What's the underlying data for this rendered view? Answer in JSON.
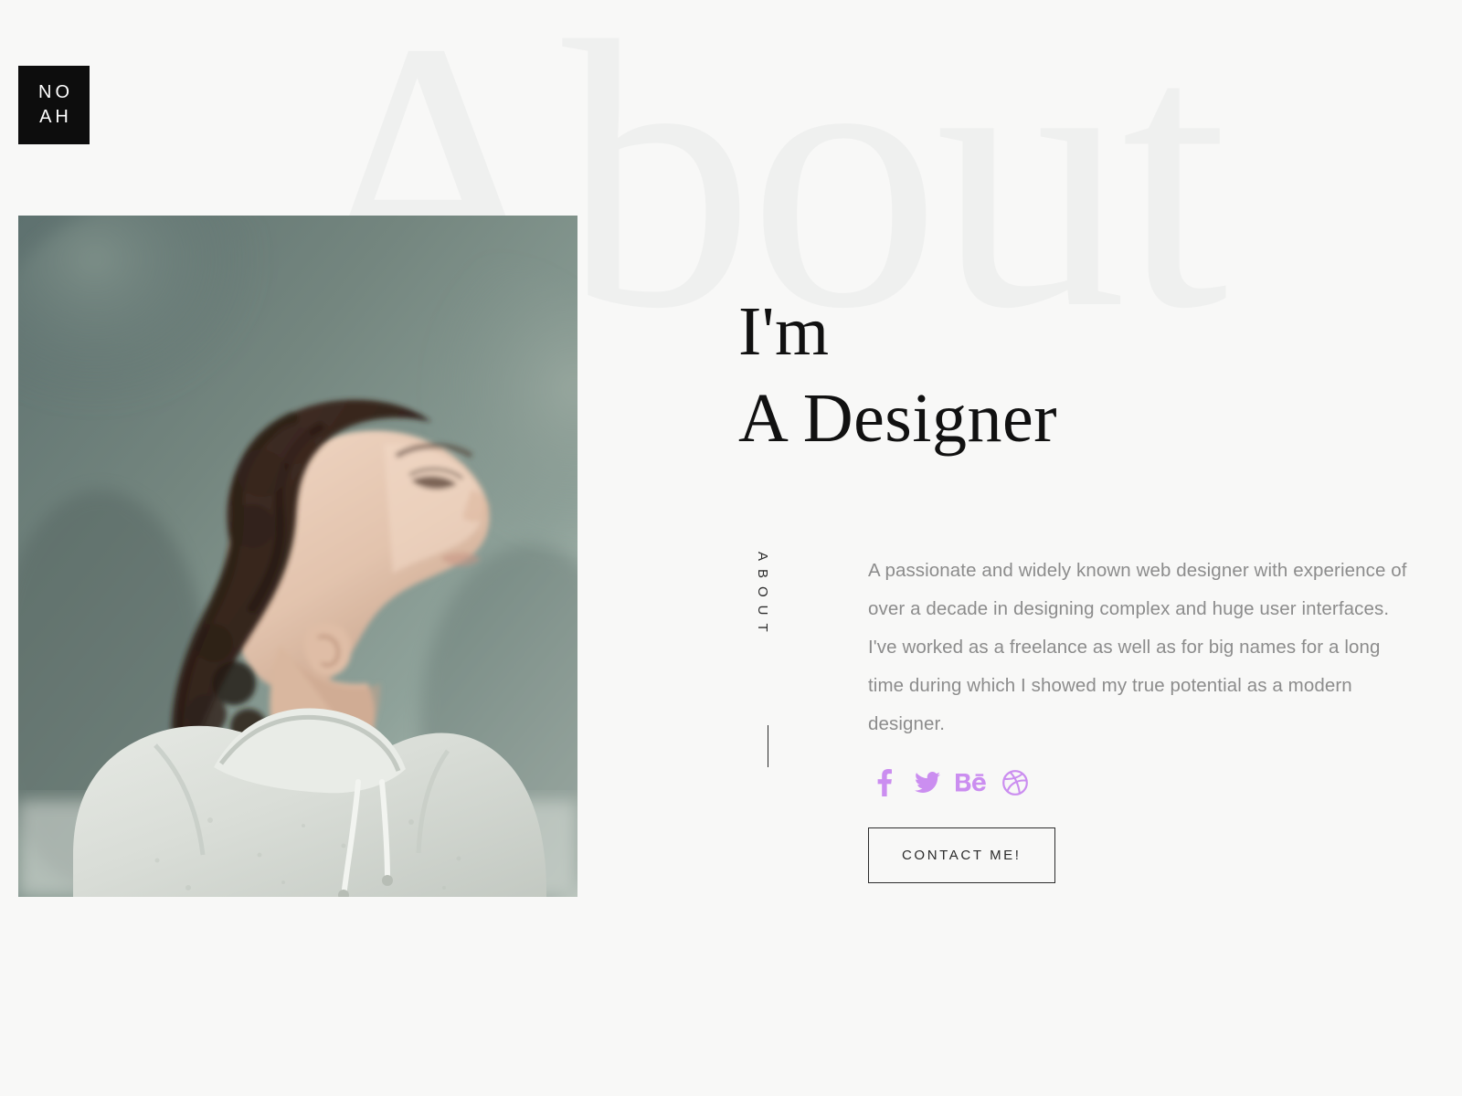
{
  "brand": {
    "logo_line1": "NO",
    "logo_line2": "AH",
    "accent_color": "#cb8ef0",
    "background_color": "#f8f8f7",
    "watermark_color": "#eff0ef",
    "text_color": "#111111",
    "body_text_color": "#8c8c8c"
  },
  "section": {
    "watermark": "About",
    "vertical_label": "ABOUT",
    "headline_line1": "I'm",
    "headline_line2": "A Designer",
    "paragraph": "A passionate and widely known web designer with experience of over a decade in designing complex and huge user interfaces. I've worked as a freelance as well as for big names for a long time during which I showed my true potential as a modern designer.",
    "cta_label": "CONTACT ME!"
  },
  "photo": {
    "alt": "Man in light gray hoodie looking upward against blurred teal forest background",
    "background_color": "#6b7e7b",
    "hoodie_color": "#dfe2dd",
    "skin_color": "#e8cdbb",
    "hair_color": "#3a2a22"
  },
  "socials": [
    {
      "name": "facebook",
      "icon": "facebook-icon",
      "glyph": "f"
    },
    {
      "name": "twitter",
      "icon": "twitter-icon",
      "glyph": "bird"
    },
    {
      "name": "behance",
      "icon": "behance-icon",
      "glyph": "Be"
    },
    {
      "name": "dribbble",
      "icon": "dribbble-icon",
      "glyph": "ball"
    }
  ]
}
